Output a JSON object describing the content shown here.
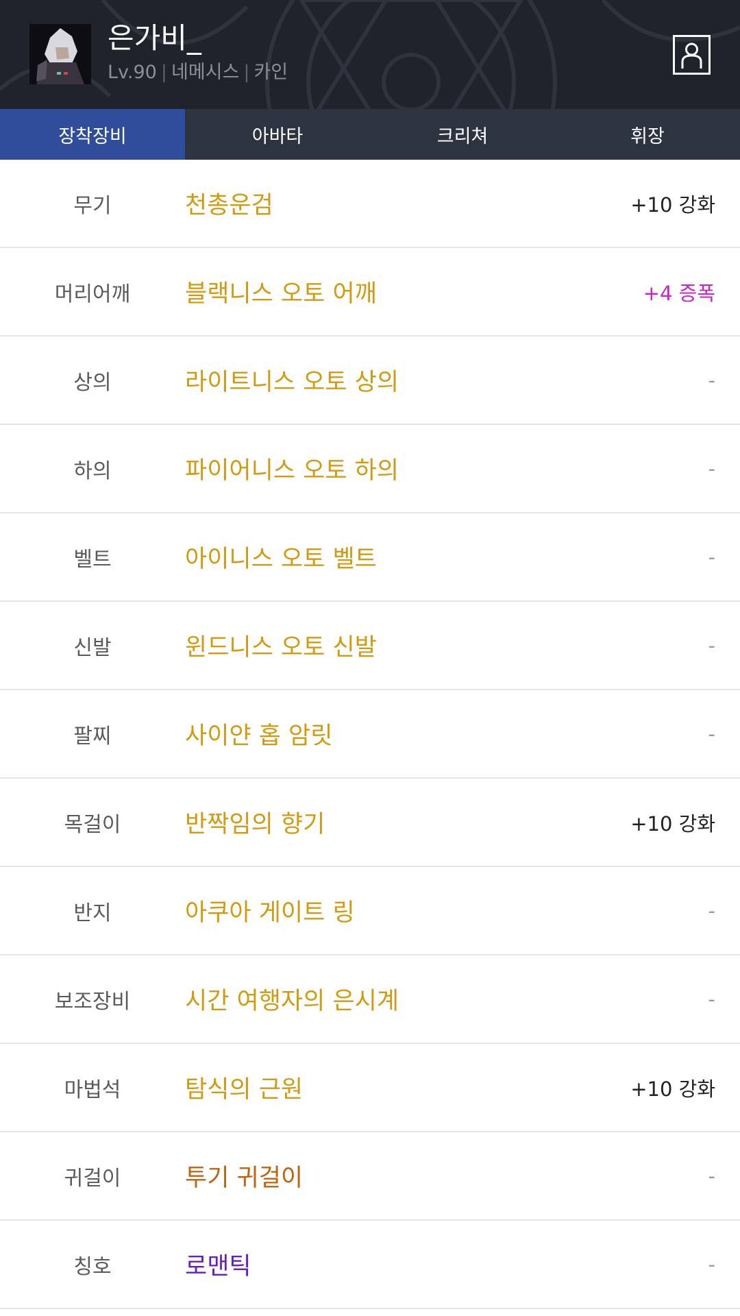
{
  "header": {
    "character_name": "은가비_",
    "level": "Lv.90",
    "job": "네메시스",
    "server": "카인",
    "separator": "|",
    "profile_icon": "user-profile-icon",
    "avatar_icon": "character-portrait"
  },
  "tabs": [
    {
      "label": "장착장비",
      "active": true
    },
    {
      "label": "아바타",
      "active": false
    },
    {
      "label": "크리쳐",
      "active": false
    },
    {
      "label": "휘장",
      "active": false
    }
  ],
  "equipment": [
    {
      "slot": "무기",
      "item": "천총운검",
      "extra": "+10 강화",
      "item_color": "#d39a10",
      "extra_color": "#222222"
    },
    {
      "slot": "머리어깨",
      "item": "블랙니스 오토 어깨",
      "extra": "+4 증폭",
      "item_color": "#d39a10",
      "extra_color": "#cc22cc"
    },
    {
      "slot": "상의",
      "item": "라이트니스 오토 상의",
      "extra": "-",
      "item_color": "#d39a10",
      "extra_color": "#9a9a9a"
    },
    {
      "slot": "하의",
      "item": "파이어니스 오토 하의",
      "extra": "-",
      "item_color": "#d39a10",
      "extra_color": "#9a9a9a"
    },
    {
      "slot": "벨트",
      "item": "아이니스 오토 벨트",
      "extra": "-",
      "item_color": "#d39a10",
      "extra_color": "#9a9a9a"
    },
    {
      "slot": "신발",
      "item": "윈드니스 오토 신발",
      "extra": "-",
      "item_color": "#d39a10",
      "extra_color": "#9a9a9a"
    },
    {
      "slot": "팔찌",
      "item": "사이얀 홉 암릿",
      "extra": "-",
      "item_color": "#d39a10",
      "extra_color": "#9a9a9a"
    },
    {
      "slot": "목걸이",
      "item": "반짝임의 향기",
      "extra": "+10 강화",
      "item_color": "#d39a10",
      "extra_color": "#222222"
    },
    {
      "slot": "반지",
      "item": "아쿠아 게이트 링",
      "extra": "-",
      "item_color": "#d39a10",
      "extra_color": "#9a9a9a"
    },
    {
      "slot": "보조장비",
      "item": "시간 여행자의 은시계",
      "extra": "-",
      "item_color": "#d39a10",
      "extra_color": "#9a9a9a"
    },
    {
      "slot": "마법석",
      "item": "탐식의 근원",
      "extra": "+10 강화",
      "item_color": "#d39a10",
      "extra_color": "#222222"
    },
    {
      "slot": "귀걸이",
      "item": "투기 귀걸이",
      "extra": "-",
      "item_color": "#c0620e",
      "extra_color": "#9a9a9a"
    },
    {
      "slot": "칭호",
      "item": "로맨틱",
      "extra": "-",
      "item_color": "#6a1ec0",
      "extra_color": "#9a9a9a"
    }
  ]
}
